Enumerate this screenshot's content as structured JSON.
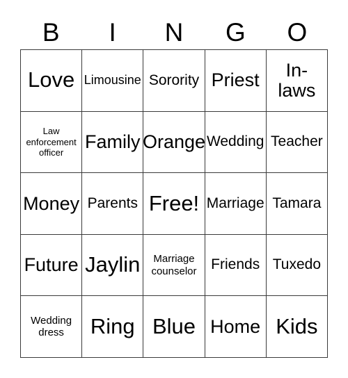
{
  "card": {
    "title_letters": [
      "B",
      "I",
      "N",
      "G",
      "O"
    ],
    "grid_columns": 5,
    "grid_rows": 5,
    "border_color": "#3a3a3a",
    "background_color": "#ffffff",
    "text_color": "#000000",
    "free_space_label": "Free!",
    "free_space_position": {
      "row": 3,
      "column": 3
    }
  },
  "cells": [
    {
      "label": "Love",
      "size": "xl",
      "column": "B",
      "row": 1
    },
    {
      "label": "Limousine",
      "size": "sm",
      "column": "I",
      "row": 1
    },
    {
      "label": "Sorority",
      "size": "md",
      "column": "N",
      "row": 1
    },
    {
      "label": "Priest",
      "size": "lg",
      "column": "G",
      "row": 1
    },
    {
      "label": "In-\nlaws",
      "size": "lg",
      "column": "O",
      "row": 1
    },
    {
      "label": "Law\nenforcement\nofficer",
      "size": "xxs",
      "column": "B",
      "row": 2
    },
    {
      "label": "Family",
      "size": "lg",
      "column": "I",
      "row": 2
    },
    {
      "label": "Orange",
      "size": "lg",
      "column": "N",
      "row": 2
    },
    {
      "label": "Wedding",
      "size": "md",
      "column": "G",
      "row": 2
    },
    {
      "label": "Teacher",
      "size": "md",
      "column": "O",
      "row": 2
    },
    {
      "label": "Money",
      "size": "lg",
      "column": "B",
      "row": 3
    },
    {
      "label": "Parents",
      "size": "md",
      "column": "I",
      "row": 3
    },
    {
      "label": "Free!",
      "size": "xl",
      "column": "N",
      "row": 3
    },
    {
      "label": "Marriage",
      "size": "md",
      "column": "G",
      "row": 3
    },
    {
      "label": "Tamara",
      "size": "md",
      "column": "O",
      "row": 3
    },
    {
      "label": "Future",
      "size": "lg",
      "column": "B",
      "row": 4
    },
    {
      "label": "Jaylin",
      "size": "xl",
      "column": "I",
      "row": 4
    },
    {
      "label": "Marriage\ncounselor",
      "size": "xs",
      "column": "N",
      "row": 4
    },
    {
      "label": "Friends",
      "size": "md",
      "column": "G",
      "row": 4
    },
    {
      "label": "Tuxedo",
      "size": "md",
      "column": "O",
      "row": 4
    },
    {
      "label": "Wedding\ndress",
      "size": "xs",
      "column": "B",
      "row": 5
    },
    {
      "label": "Ring",
      "size": "xl",
      "column": "I",
      "row": 5
    },
    {
      "label": "Blue",
      "size": "xl",
      "column": "N",
      "row": 5
    },
    {
      "label": "Home",
      "size": "lg",
      "column": "G",
      "row": 5
    },
    {
      "label": "Kids",
      "size": "xl",
      "column": "O",
      "row": 5
    }
  ]
}
